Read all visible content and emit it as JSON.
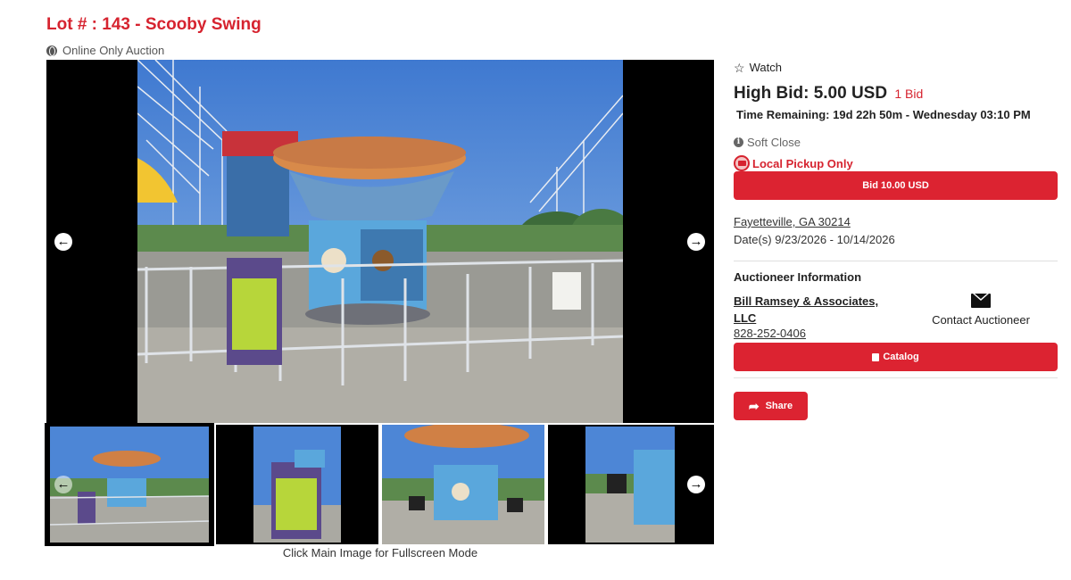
{
  "lot": {
    "title": "Lot # : 143 - Scooby Swing",
    "auction_type": "Online Only Auction"
  },
  "viewer": {
    "prev_icon": "arrow-left-circle-icon",
    "next_icon": "arrow-right-circle-icon",
    "caption": "Click Main Image for Fullscreen Mode",
    "thumbnail_count": 4
  },
  "bidding": {
    "watch_label": "Watch",
    "high_bid": "High Bid: 5.00 USD",
    "bid_count": "1 Bid",
    "time_remaining": "Time Remaining: 19d 22h 50m - Wednesday 03:10 PM",
    "soft_close": "Soft Close",
    "pickup": "Local Pickup Only",
    "bid_button": "Bid 10.00 USD"
  },
  "location": {
    "city": "Fayetteville, GA 30214",
    "dates": "Date(s) 9/23/2026 - 10/14/2026"
  },
  "auctioneer": {
    "heading": "Auctioneer Information",
    "name": "Bill Ramsey & Associates, LLC",
    "phone": "828-252-0406",
    "contact_label": "Contact Auctioneer"
  },
  "actions": {
    "catalog_label": "Catalog",
    "share_label": "Share"
  },
  "colors": {
    "accent": "#dc2331",
    "title": "#d6232f"
  }
}
